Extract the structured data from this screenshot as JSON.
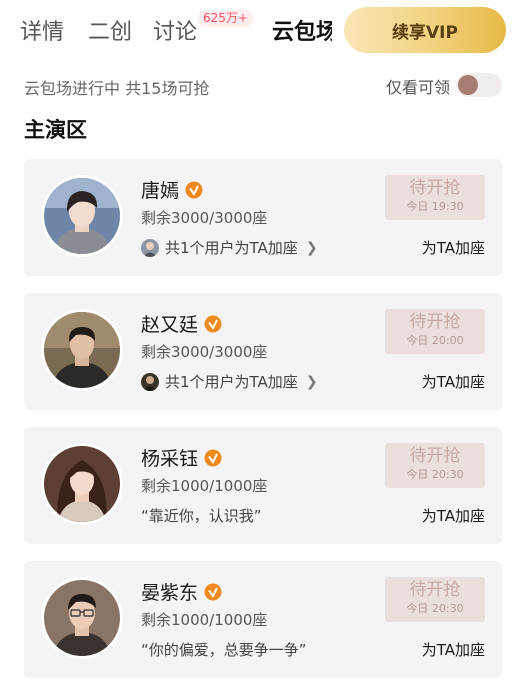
{
  "tabs": [
    {
      "label": "详情"
    },
    {
      "label": "二创"
    },
    {
      "label": "讨论",
      "badge": "625万+"
    },
    {
      "label": "云包场"
    }
  ],
  "vip_button": "续享VIP",
  "status_text": "云包场进行中 共15场可抢",
  "only_view_label": "仅看可领",
  "section_title": "主演区",
  "accent_color": "#f08a1c",
  "cards": [
    {
      "name": "唐嫣",
      "seats": "剩余3000/3000座",
      "users": "共1个用户为TA加座",
      "grab": "待开抢",
      "time": "今日 19:30",
      "add": "为TA加座"
    },
    {
      "name": "赵又廷",
      "seats": "剩余3000/3000座",
      "users": "共1个用户为TA加座",
      "grab": "待开抢",
      "time": "今日 20:00",
      "add": "为TA加座"
    },
    {
      "name": "杨采钰",
      "seats": "剩余1000/1000座",
      "quote": "“靠近你，认识我”",
      "grab": "待开抢",
      "time": "今日 20:30",
      "add": "为TA加座"
    },
    {
      "name": "晏紫东",
      "seats": "剩余1000/1000座",
      "quote": "“你的偏爱，总要争一争”",
      "grab": "待开抢",
      "time": "今日 20:30",
      "add": "为TA加座"
    }
  ]
}
